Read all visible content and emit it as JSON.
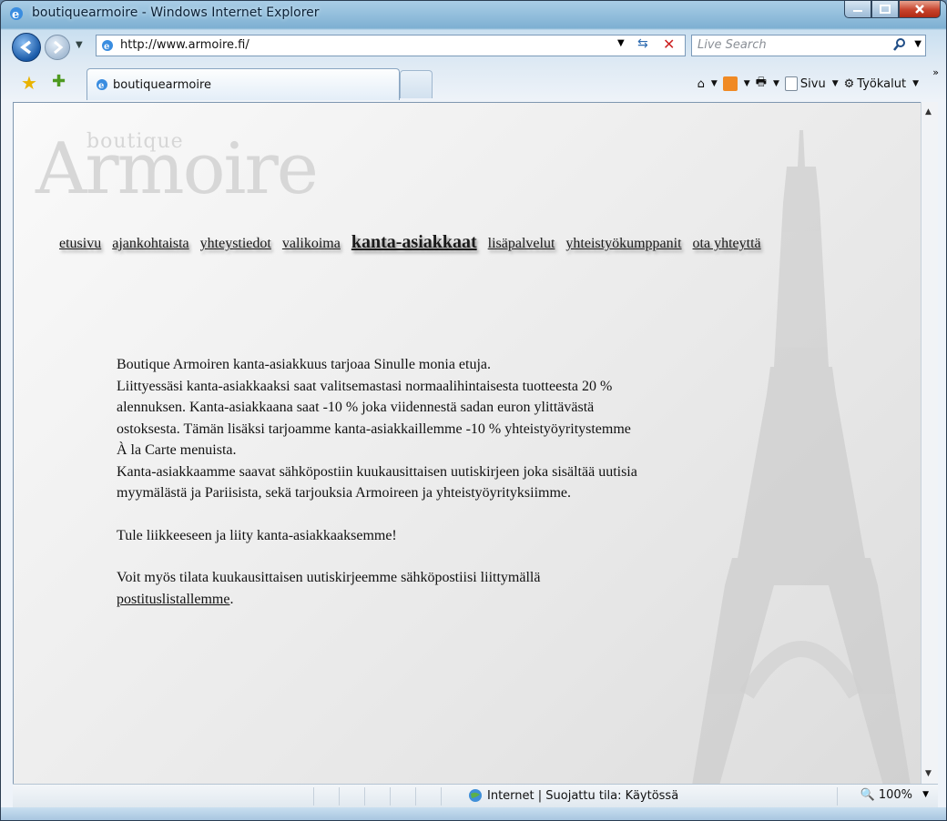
{
  "window": {
    "title": "boutiquearmoire - Windows Internet Explorer"
  },
  "address": {
    "url": "http://www.armoire.fi/",
    "search_placeholder": "Live Search"
  },
  "tab": {
    "label": "boutiquearmoire"
  },
  "commands": {
    "page": "Sivu",
    "tools": "Työkalut"
  },
  "site": {
    "logo_small": "boutique",
    "logo_big": "Armoire",
    "nav": [
      {
        "label": "etusivu"
      },
      {
        "label": "ajankohtaista"
      },
      {
        "label": "yhteystiedot"
      },
      {
        "label": "valikoima"
      },
      {
        "label": "kanta-asiakkaat",
        "active": true
      },
      {
        "label": "lisäpalvelut"
      },
      {
        "label": "yhteistyökumppanit"
      },
      {
        "label": "ota yhteyttä"
      }
    ],
    "content": {
      "l1": "Boutique Armoiren kanta-asiakkuus tarjoaa Sinulle monia etuja.",
      "l2": "Liittyessäsi kanta-asiakkaaksi saat valitsemastasi normaalihintaisesta tuotteesta  20 %",
      "l3": "alennuksen. Kanta-asiakkaana saat -10 % joka viidennestä sadan euron ylittävästä",
      "l4": "ostoksesta. Tämän lisäksi tarjoamme kanta-asiakkaillemme -10 % yhteistyöyritystemme",
      "l5": "À la Carte menuista.",
      "l6": "Kanta-asiakkaamme saavat sähköpostiin kuukausittaisen uutiskirjeen joka sisältää uutisia",
      "l7": "myymälästä ja Pariisista, sekä tarjouksia Armoireen ja yhteistyöyrityksiimme.",
      "l8": "Tule liikkeeseen ja liity kanta-asiakkaaksemme!",
      "l9": "Voit myös tilata kuukausittaisen uutiskirjeemme sähköpostiisi liittymällä",
      "link": "postituslistallemme",
      "link_after": "."
    }
  },
  "status": {
    "zone": "Internet | Suojattu tila: Käytössä",
    "zoom": "100%"
  },
  "colors": {
    "accent": "#1a5aa8",
    "text": "#111111",
    "watermark": "#d7d7d7"
  }
}
